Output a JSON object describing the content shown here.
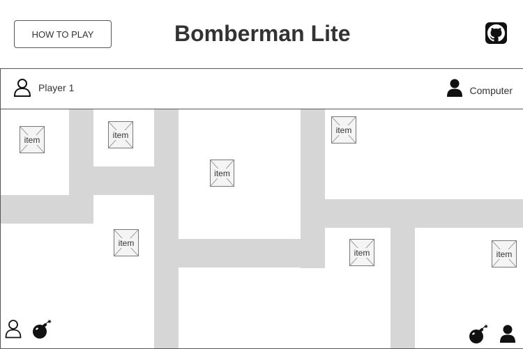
{
  "header": {
    "how_to_play_label": "HOW TO PLAY",
    "title": "Bomberman Lite",
    "github_icon": "github-icon"
  },
  "players": {
    "player1": {
      "label": "Player 1",
      "icon": "user-outline-icon"
    },
    "player2": {
      "label": "Computer",
      "icon": "user-filled-icon"
    }
  },
  "board": {
    "item_label": "item",
    "items": [
      "item",
      "item",
      "item",
      "item",
      "item",
      "item",
      "item"
    ],
    "wall_color": "#d6d6d6",
    "bomb_icon": "bomb-icon"
  }
}
